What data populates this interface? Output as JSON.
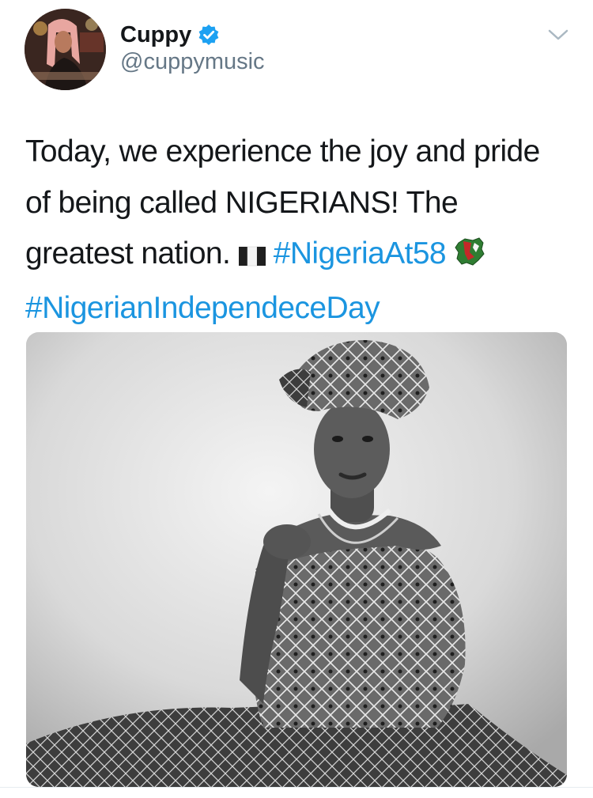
{
  "tweet": {
    "display_name": "Cuppy",
    "handle": "@cuppymusic",
    "verified": true,
    "text_part1": "Today, we experience the joy and pride of being called NIGERIANS! The greatest nation.",
    "hashtag1": "#NigeriaAt58",
    "hashtag2": "#NigerianIndependeceDay",
    "emoji1": "nigeria-flag-icon",
    "emoji2": "nigeria-map-icon"
  },
  "icons": {
    "verified": "verified-badge-icon",
    "menu": "chevron-down-icon"
  },
  "colors": {
    "link": "#1b95e0",
    "verified": "#1da1f2",
    "secondary_text": "#657786",
    "primary_text": "#14171a"
  }
}
